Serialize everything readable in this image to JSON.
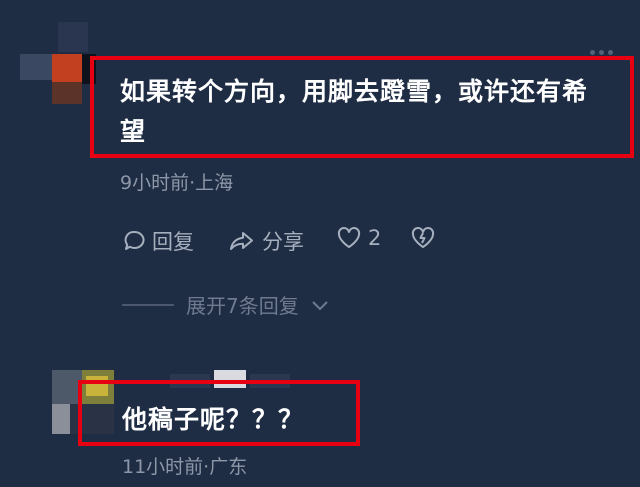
{
  "comments": [
    {
      "text": "如果转个方向，用脚去蹬雪，或许还有希望",
      "line1": "如果转个方向，用脚去蹬雪，或许还有希",
      "line2": "望",
      "meta": "9小时前·上海",
      "actions": {
        "reply_label": "回复",
        "share_label": "分享",
        "like_count": "2"
      },
      "expand_label": "展开7条回复"
    },
    {
      "text": "他稿子呢？？？",
      "meta": "11小时前·广东"
    }
  ],
  "colors": {
    "background": "#1e2c44",
    "highlight_box": "#e60012",
    "meta_text": "#8d97a8",
    "action_text": "#a6afbd"
  },
  "icons": [
    "reply-icon",
    "share-icon",
    "like-icon",
    "dislike-icon",
    "chevron-down-icon",
    "more-icon"
  ]
}
